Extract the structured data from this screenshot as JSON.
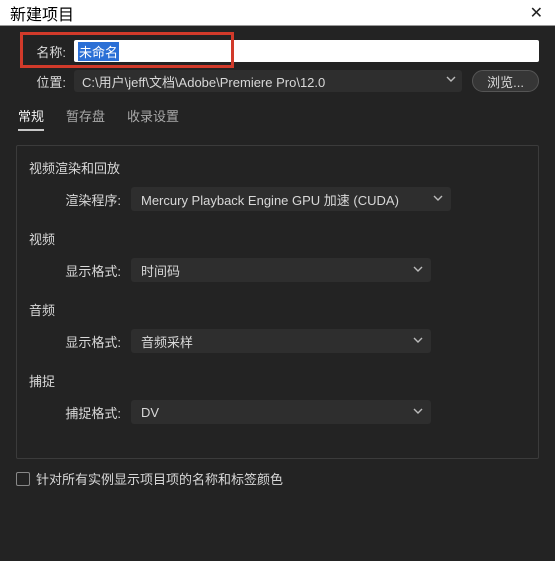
{
  "titlebar": {
    "title": "新建项目",
    "close": "✕"
  },
  "name": {
    "label": "名称:",
    "value": "未命名"
  },
  "location": {
    "label": "位置:",
    "value": "C:\\用户\\jeff\\文档\\Adobe\\Premiere Pro\\12.0",
    "browse": "浏览..."
  },
  "tabs": {
    "general": "常规",
    "scratch": "暂存盘",
    "ingest": "收录设置"
  },
  "sections": {
    "render": {
      "title": "视频渲染和回放",
      "row_label": "渲染程序:",
      "value": "Mercury Playback Engine GPU 加速 (CUDA)"
    },
    "video": {
      "title": "视频",
      "row_label": "显示格式:",
      "value": "时间码"
    },
    "audio": {
      "title": "音频",
      "row_label": "显示格式:",
      "value": "音频采样"
    },
    "capture": {
      "title": "捕捉",
      "row_label": "捕捉格式:",
      "value": "DV"
    }
  },
  "checkbox": {
    "label": "针对所有实例显示项目项的名称和标签颜色"
  }
}
